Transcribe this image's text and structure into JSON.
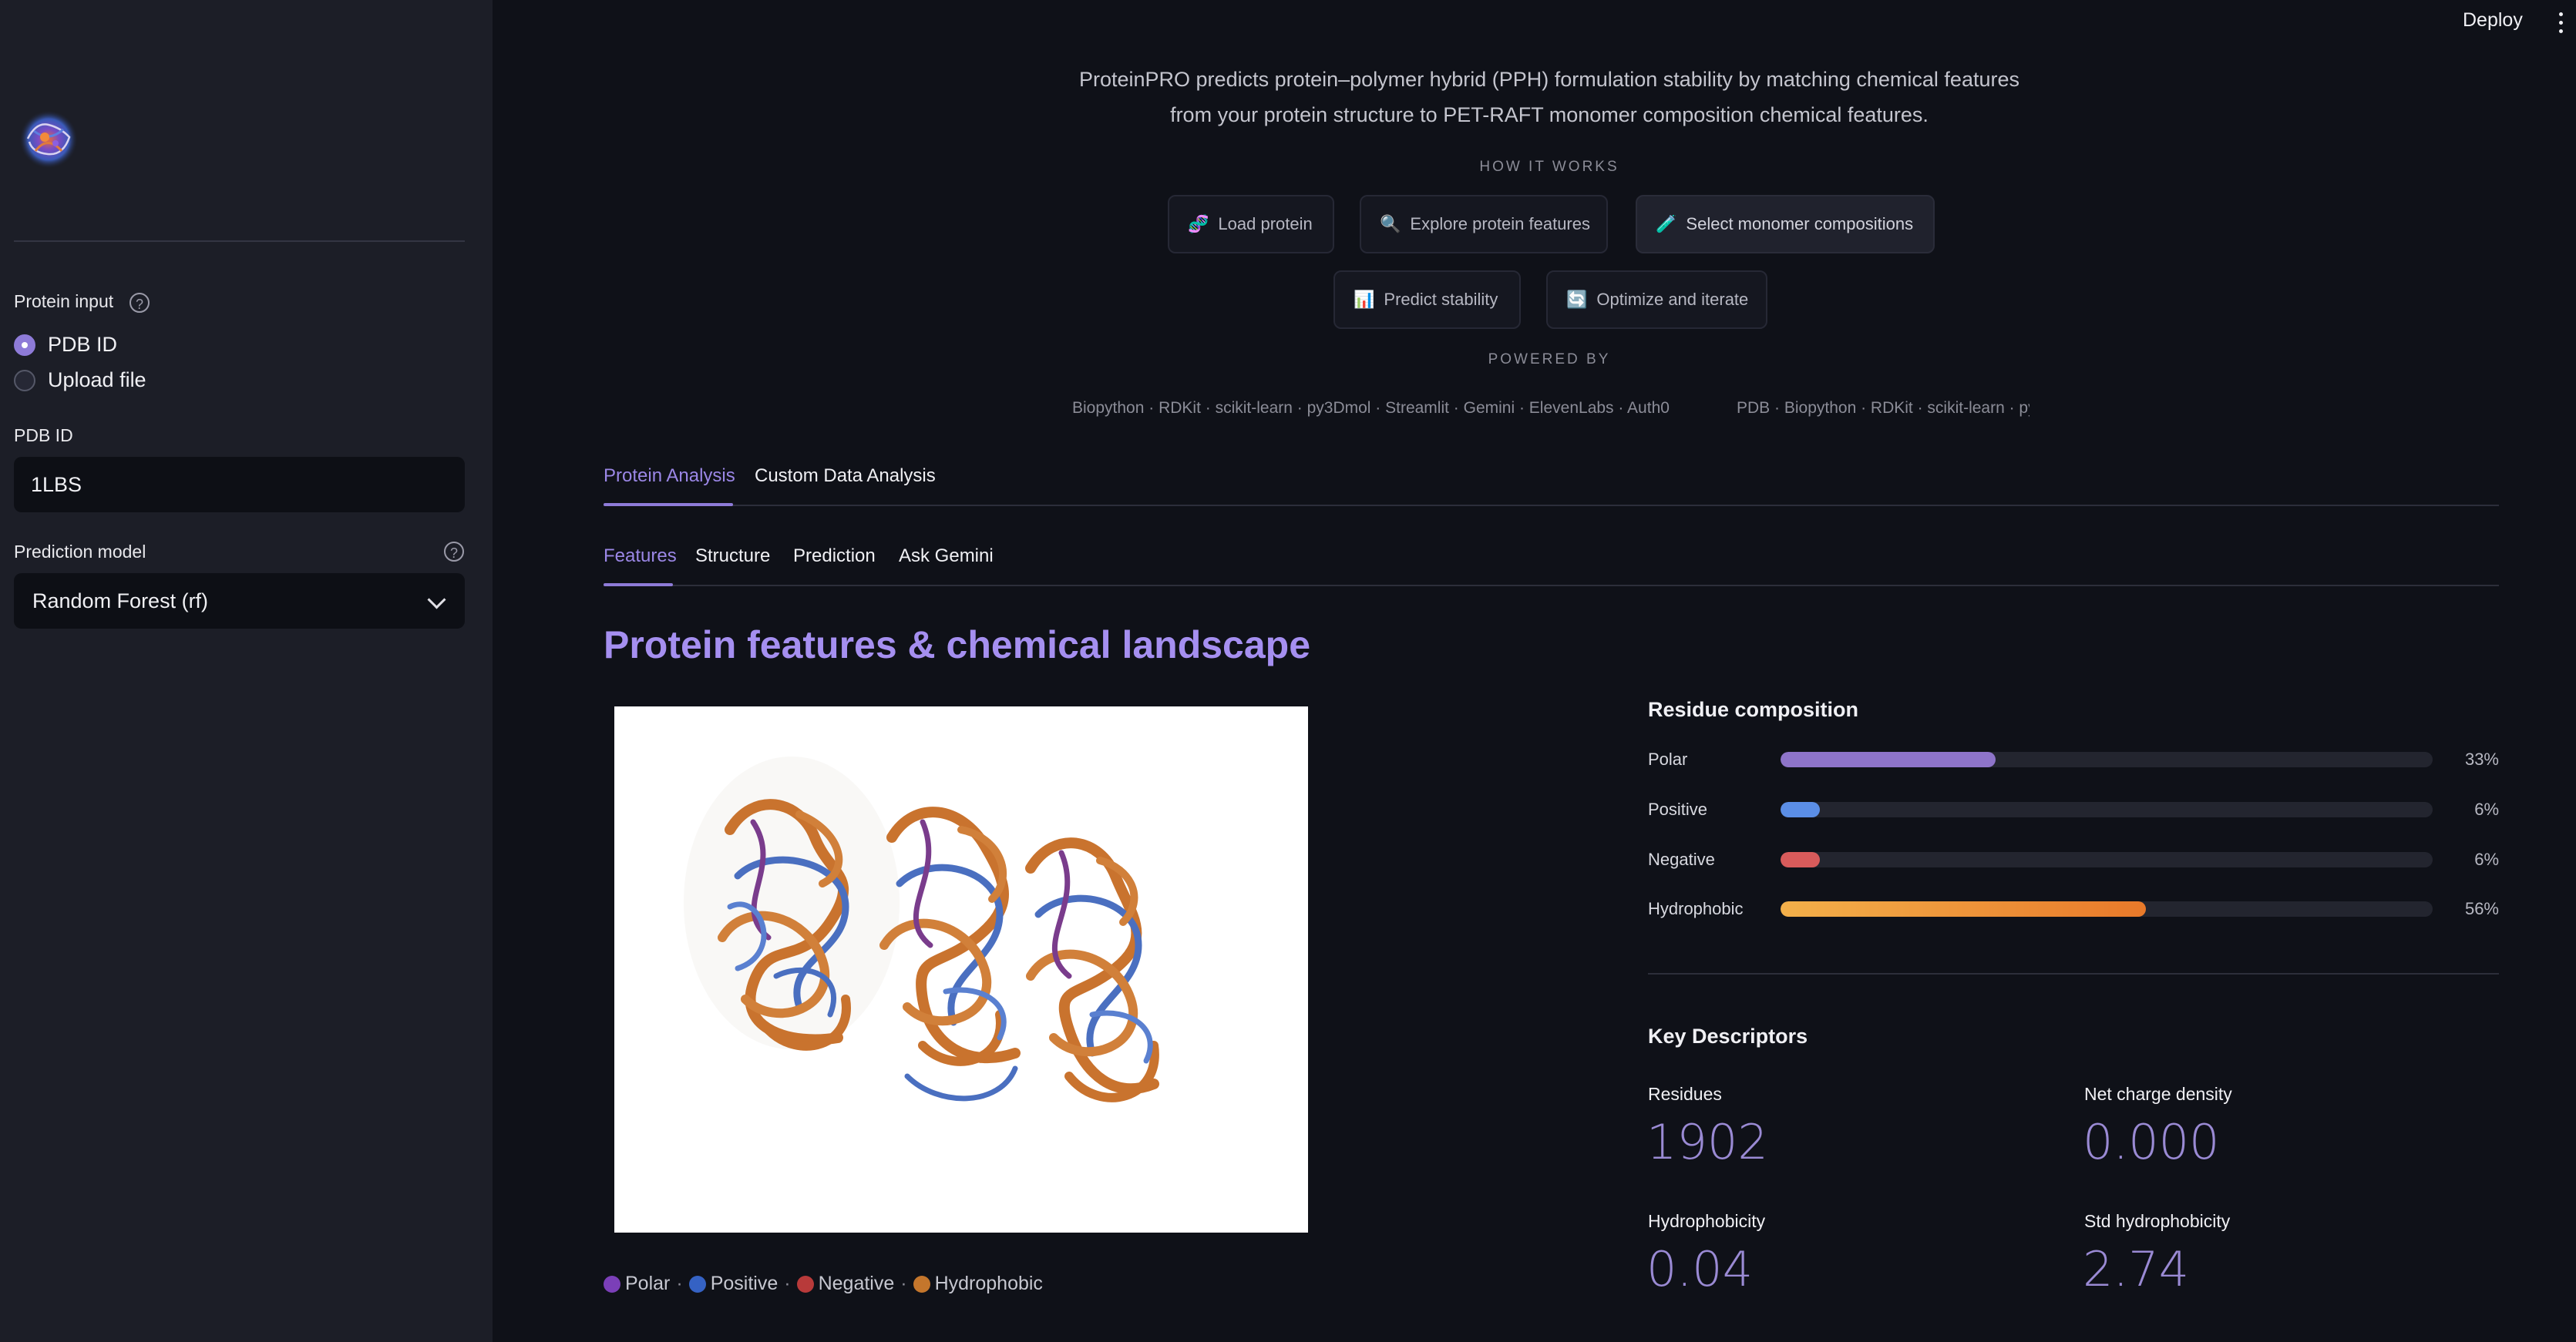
{
  "header": {
    "deploy_label": "Deploy",
    "menu_icon": "kebab-menu-icon"
  },
  "sidebar": {
    "logo_icon": "protein-logo-icon",
    "protein_input": {
      "label": "Protein input",
      "options": [
        "PDB ID",
        "Upload file"
      ],
      "selected": "PDB ID"
    },
    "pdb_id": {
      "label": "PDB ID",
      "value": "1LBS"
    },
    "prediction_model": {
      "label": "Prediction model",
      "value": "Random Forest (rf)"
    }
  },
  "intro": {
    "line1": "ProteinPRO predicts protein–polymer hybrid (PPH) formulation stability by matching chemical features",
    "line2": "from your protein structure to PET-RAFT monomer composition chemical features.",
    "how_it_works": "HOW IT WORKS",
    "steps": [
      {
        "icon": "🧬",
        "label": "Load protein"
      },
      {
        "icon": "🔍",
        "label": "Explore protein features"
      },
      {
        "icon": "🧪",
        "label": "Select monomer compositions"
      },
      {
        "icon": "📊",
        "label": "Predict stability"
      },
      {
        "icon": "🔄",
        "label": "Optimize and iterate"
      }
    ],
    "powered_by": "POWERED BY",
    "powered_list_1": "Biopython · RDKit · scikit-learn · py3Dmol · Streamlit · Gemini · ElevenLabs · Auth0",
    "powered_list_2": "PDB · Biopython · RDKit · scikit-learn · py"
  },
  "tabs": {
    "main": [
      "Protein Analysis",
      "Custom Data Analysis"
    ],
    "sub": [
      "Features",
      "Structure",
      "Prediction",
      "Ask Gemini"
    ]
  },
  "features": {
    "title": "Protein features & chemical landscape",
    "legend": [
      {
        "label": "Polar",
        "color": "#7b3fb8"
      },
      {
        "label": "Positive",
        "color": "#3562c4"
      },
      {
        "label": "Negative",
        "color": "#b83a3a"
      },
      {
        "label": "Hydrophobic",
        "color": "#c4762c"
      }
    ],
    "residue_composition": {
      "title": "Residue composition",
      "rows": [
        {
          "label": "Polar",
          "value": 0.33,
          "display": "33%",
          "color": "#8e74c9"
        },
        {
          "label": "Positive",
          "value": 0.06,
          "display": "6%",
          "color": "#5b8ee6"
        },
        {
          "label": "Negative",
          "value": 0.06,
          "display": "6%",
          "color": "#d85b5b"
        },
        {
          "label": "Hydrophobic",
          "value": 0.56,
          "display": "56%",
          "color": "#eb8f33"
        }
      ]
    },
    "key_descriptors": {
      "title": "Key Descriptors",
      "residues_label": "Residues",
      "residues_value": "1902",
      "net_charge_label": "Net charge density",
      "net_charge_value": "0.000",
      "hydrophobicity_label": "Hydrophobicity",
      "hydrophobicity_value": "0.04",
      "std_hydrophobicity_label": "Std hydrophobicity",
      "std_hydrophobicity_value": "2.74"
    }
  }
}
